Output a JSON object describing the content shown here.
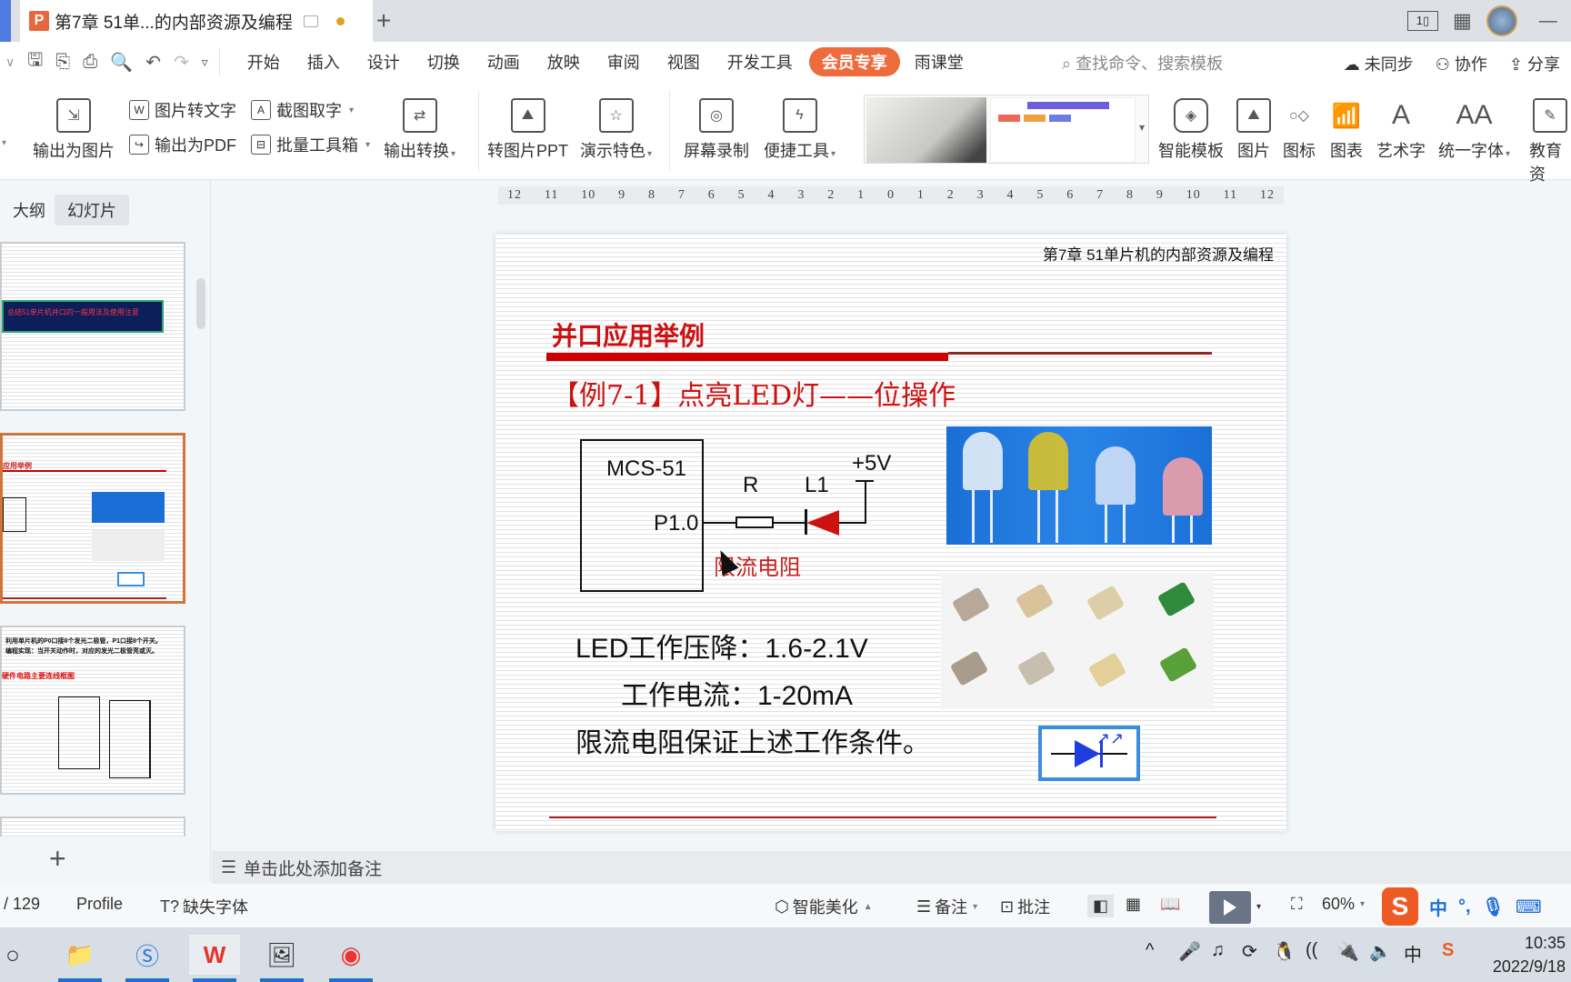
{
  "window": {
    "doc_tab_title": "第7章  51单...的内部资源及编程",
    "app_logo": "P",
    "new_tab_icon": "+"
  },
  "menubar": {
    "items": [
      "开始",
      "插入",
      "设计",
      "切换",
      "动画",
      "放映",
      "审阅",
      "视图",
      "开发工具"
    ],
    "vip_label": "会员专享",
    "rain_classroom": "雨课堂",
    "search_placeholder": "查找命令、搜索模板",
    "sync_label": "未同步",
    "collab_label": "协作",
    "share_label": "分享"
  },
  "ribbon": {
    "export_image": "输出为图片",
    "image_to_text": "图片转文字",
    "screenshot_text": "截图取字",
    "export_pdf": "输出为PDF",
    "batch_toolbox": "批量工具箱",
    "export_convert": "输出转换",
    "to_image_ppt": "转图片PPT",
    "presentation_features": "演示特色",
    "screen_record": "屏幕录制",
    "quick_tools": "便捷工具",
    "smart_template": "智能模板",
    "picture": "图片",
    "icon": "图标",
    "chart": "图表",
    "word_art": "艺术字",
    "unify_font": "统一字体",
    "education": "教育资"
  },
  "left_panel": {
    "tab_outline": "大纲",
    "tab_slides": "幻灯片",
    "thumb1_text": "总结51单片机并口的一般用法及使用注意",
    "thumb3_text": "利用单片机的P0口接8个发光二极管，P1口接8个开关。编程实现：当开关动作时，对应的发光二极管亮或灭。",
    "thumb3_subtitle": "硬件电路主要连线框图"
  },
  "ruler": {
    "ticks": [
      "12",
      "11",
      "10",
      "9",
      "8",
      "7",
      "6",
      "5",
      "4",
      "3",
      "2",
      "1",
      "0",
      "1",
      "2",
      "3",
      "4",
      "5",
      "6",
      "7",
      "8",
      "9",
      "10",
      "11",
      "12"
    ]
  },
  "slide": {
    "header": "第7章  51单片机的内部资源及编程",
    "title": "并口应用举例",
    "example_title": "【例7-1】点亮LED灯——位操作",
    "mcu_label": "MCS-51",
    "pin_label": "P1.0",
    "resistor_label": "R",
    "led_label": "L1",
    "supply_label": "+5V",
    "resistor_note": "限流电阻",
    "spec_voltage": "LED工作压降：1.6-2.1V",
    "spec_current": "工作电流：1-20mA",
    "spec_note": "限流电阻保证上述工作条件。"
  },
  "notes": {
    "placeholder": "单击此处添加备注"
  },
  "statusbar": {
    "page_count": "/ 129",
    "profile": "Profile",
    "missing_font": "缺失字体",
    "smart_beautify": "智能美化",
    "notes": "备注",
    "comment": "批注",
    "zoom": "60%"
  },
  "ime": {
    "logo": "S",
    "mode": "中",
    "punct": "°,"
  },
  "taskbar": {
    "time": "10:35",
    "date": "2022/9/18",
    "tray_lang": "中"
  },
  "colors": {
    "accent_red": "#cc1111",
    "vip_orange": "#ee6b3b",
    "selected_thumb": "#d2733a"
  }
}
